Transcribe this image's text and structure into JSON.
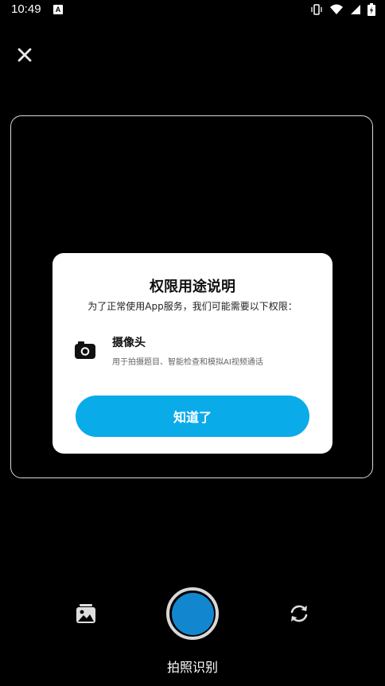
{
  "status_bar": {
    "time": "10:49",
    "notification_glyph": "A",
    "icons": [
      "vibrate-icon",
      "wifi-icon",
      "signal-icon",
      "battery-charging-icon"
    ]
  },
  "camera": {
    "close_icon": "close-icon",
    "capture_label": "拍照识别",
    "gallery_icon": "gallery-icon",
    "flip_icon": "switch-camera-icon",
    "accent_color": "#1287cf"
  },
  "dialog": {
    "title": "权限用途说明",
    "subtitle": "为了正常使用App服务，我们可能需要以下权限：",
    "permission": {
      "icon": "camera-icon",
      "title": "摄像头",
      "description": "用于拍摄题目、智能检查和模拟AI视频通话"
    },
    "confirm_label": "知道了",
    "confirm_color": "#0aabe9"
  }
}
